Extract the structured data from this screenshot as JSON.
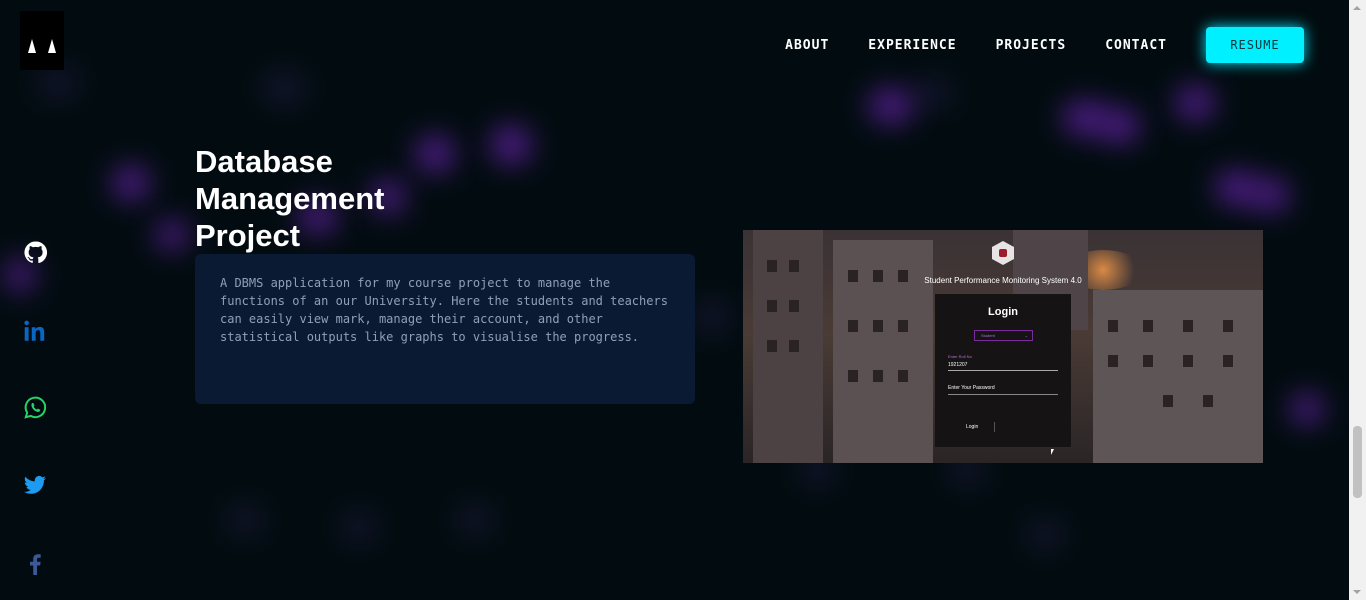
{
  "brand": {
    "logo_icon": "cat-logo-icon"
  },
  "nav": {
    "items": [
      "ABOUT",
      "EXPERIENCE",
      "PROJECTS",
      "CONTACT"
    ],
    "resume_label": "RESUME",
    "resume_color": "#00f0ff"
  },
  "social": [
    {
      "icon": "github-icon",
      "color": "#ffffff"
    },
    {
      "icon": "linkedin-icon",
      "color": "#0a66c2"
    },
    {
      "icon": "whatsapp-icon",
      "color": "#25d366"
    },
    {
      "icon": "twitter-icon",
      "color": "#1d9bf0"
    },
    {
      "icon": "facebook-icon",
      "color": "#3b5998"
    }
  ],
  "project": {
    "title_lines": [
      "Database",
      "Management",
      "Project"
    ],
    "description": "A DBMS application for my course project to manage the functions of an our University. Here the students and teachers can easily view mark, manage their account, and other statistical outputs like graphs to visualise the progress.",
    "screenshot": {
      "app_title": "Student Performance Monitoring System 4.0",
      "login_heading": "Login",
      "role_selected": "Student",
      "roll_label": "Enter Roll No",
      "roll_value": "1921207",
      "password_placeholder": "Enter Your Password",
      "login_button": "Login"
    }
  }
}
